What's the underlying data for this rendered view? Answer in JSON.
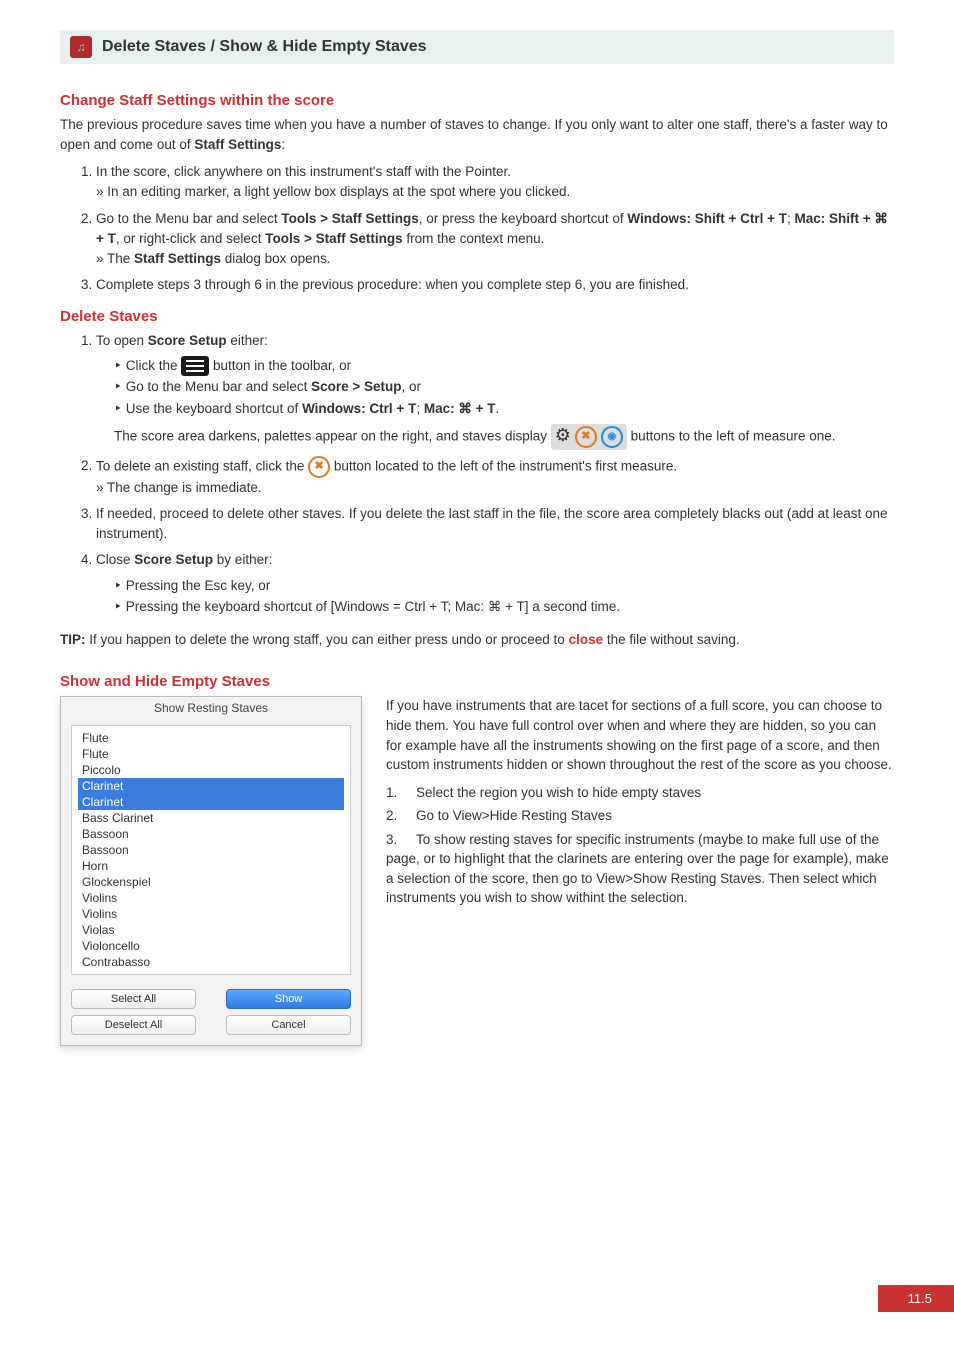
{
  "header": {
    "title": "Delete Staves / Show & Hide Empty Staves"
  },
  "section_change_staff": {
    "heading": "Change Staff Settings within the score",
    "intro1": "The previous procedure saves time when you have a number of staves to change. If you only want to alter one staff, there's a faster way to open and come out of ",
    "intro_bold": "Staff Settings",
    "step1_a": "In the score, click anywhere on this instrument's staff with the Pointer.",
    "step1_b": "» In an editing marker, a light yellow box displays at the spot where you clicked.",
    "step2_a1": "Go to the Menu bar and select ",
    "step2_tools": "Tools > Staff Settings",
    "step2_a2": ", or press the keyboard shortcut of ",
    "step2_win": "Windows: Shift + Ctrl + T",
    "step2_mac_lbl": "Mac: Shift + ⌘ + T",
    "step2_rc": ", or right-click and select ",
    "step2_ts": "Tools > Staff Settings",
    "step2_ctx": " from the context menu.",
    "step2_b": "» The ",
    "step2_b_bold": "Staff Settings",
    "step2_b2": " dialog box opens.",
    "step3": "Complete steps 3 through 6 in the previous procedure: when you complete step 6, you are finished."
  },
  "section_delete": {
    "heading": "Delete Staves",
    "step1_intro": "To open ",
    "step1_bold": "Score Setup",
    "step1_end": " either:",
    "bullets": {
      "b1a": "Click the ",
      "b1b": " button in the toolbar, or",
      "b2": "Go to the Menu bar and select ",
      "b2_bold": "Score > Setup",
      "b2_end": ", or",
      "b3a": "Use the keyboard shortcut of ",
      "b3_win": "Windows: Ctrl + T",
      "b3_sep": "; ",
      "b3_mac": "Mac: ⌘ + T",
      "b3_end": "."
    },
    "after_bullets1": "The score area darkens, palettes appear on the right, and staves display ",
    "after_bullets2": " buttons to the left of measure one.",
    "step2a": "To delete an existing staff, click the ",
    "step2b": " button located to the left of the instrument's first measure.",
    "step2c": "» The change is immediate.",
    "step3": "If needed, proceed to delete other staves. If you delete the last staff in the file, the score area completely blacks out (add at least one instrument).",
    "step4_intro": "Close ",
    "step4_bold": "Score Setup",
    "step4_end": " by either:",
    "step4_b1": "Pressing the Esc key, or",
    "step4_b2": "Pressing the keyboard shortcut of [Windows = Ctrl + T; Mac: ⌘ + T] a second time.",
    "tip_label": "TIP:",
    "tip_body1": " If you happen to delete the wrong staff, you can either press undo or proceed to ",
    "tip_close": "close",
    "tip_body2": " the file without saving."
  },
  "section_show_hide": {
    "heading": "Show and Hide Empty Staves",
    "dialog_title": "Show Resting Staves",
    "instruments": [
      {
        "name": "Flute",
        "sel": false
      },
      {
        "name": "Flute",
        "sel": false
      },
      {
        "name": "Piccolo",
        "sel": false
      },
      {
        "name": "Clarinet",
        "sel": true
      },
      {
        "name": "Clarinet",
        "sel": true
      },
      {
        "name": "Bass Clarinet",
        "sel": false
      },
      {
        "name": "Bassoon",
        "sel": false
      },
      {
        "name": "Bassoon",
        "sel": false
      },
      {
        "name": "Horn",
        "sel": false
      },
      {
        "name": "Glockenspiel",
        "sel": false
      },
      {
        "name": "Violins",
        "sel": false
      },
      {
        "name": "Violins",
        "sel": false
      },
      {
        "name": "Violas",
        "sel": false
      },
      {
        "name": "Violoncello",
        "sel": false
      },
      {
        "name": "Contrabasso",
        "sel": false
      }
    ],
    "btn_select_all": "Select All",
    "btn_show": "Show",
    "btn_deselect_all": "Deselect All",
    "btn_cancel": "Cancel",
    "para1": "If you have instruments that are tacet for sections of a full score, you can choose to hide them. You have full control over when and where they are hidden, so you can for example have all the instruments showing on the first page of a score, and then custom instruments hidden or shown throughout the rest of the score as you choose.",
    "num1": "Select the region you wish to hide empty staves",
    "num2": "Go to View>Hide Resting Staves",
    "num3": "To show resting staves for specific instruments (maybe to make full use of the page, or to highlight that the clarinets are entering over the page for example), make a selection of the score, then go to View>Show Resting Staves. Then select which instruments you wish to show withint the selection."
  },
  "page_number": "11.5"
}
